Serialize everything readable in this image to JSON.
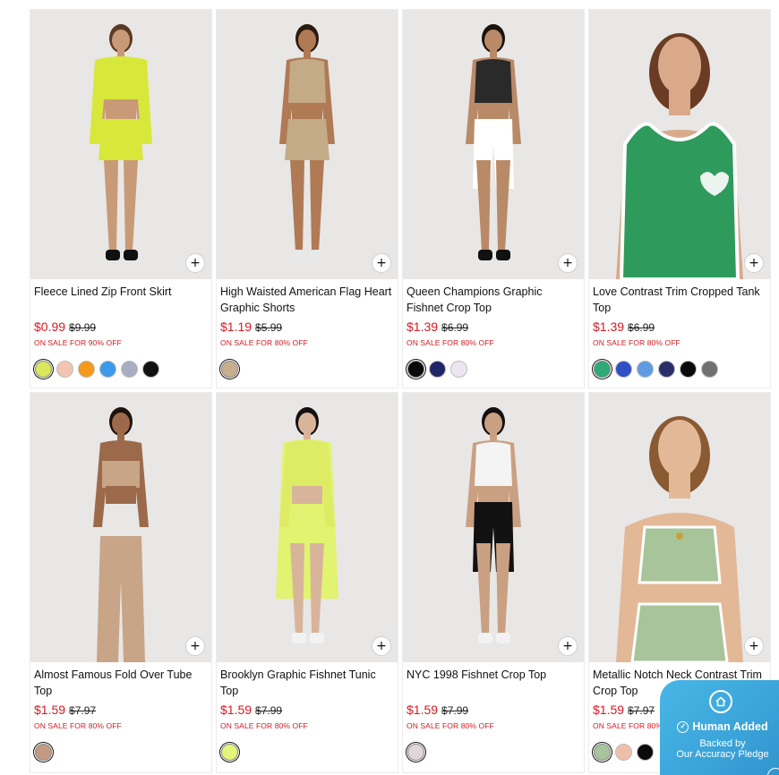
{
  "products": [
    {
      "name": "Fleece Lined Zip Front Skirt",
      "price": "$0.99",
      "original_price": "$9.99",
      "sale_text": "ON SALE FOR 90% OFF",
      "quick_add": "+",
      "outfit": {
        "top": "#d8e83a",
        "bottom": "#d8e83a",
        "skin": "#c99a78",
        "hair": "#5a3a22",
        "shoes": "#111111",
        "style": "skirt"
      },
      "swatches": [
        {
          "color": "#d9e85a",
          "selected": true
        },
        {
          "color": "#f3c4b2",
          "selected": false
        },
        {
          "color": "#f39a1c",
          "selected": false
        },
        {
          "color": "#3b9be8",
          "selected": false
        },
        {
          "color": "#a9acc3",
          "selected": false
        },
        {
          "color": "#111111",
          "selected": false
        }
      ]
    },
    {
      "name": "High Waisted American Flag Heart Graphic Shorts",
      "price": "$1.19",
      "original_price": "$5.99",
      "sale_text": "ON SALE FOR 80% OFF",
      "quick_add": "+",
      "outfit": {
        "top": "#c4ab88",
        "bottom": "#c4ab88",
        "skin": "#b07a55",
        "hair": "#2a1a10",
        "shoes": "#e8e8e8",
        "style": "shorts"
      },
      "swatches": [
        {
          "color": "#c9ad8c",
          "selected": true
        }
      ]
    },
    {
      "name": "Queen Champions Graphic Fishnet Crop Top",
      "price": "$1.39",
      "original_price": "$6.99",
      "sale_text": "ON SALE FOR 80% OFF",
      "quick_add": "+",
      "outfit": {
        "top": "#2a2a2a",
        "bottom": "#ffffff",
        "skin": "#b98a68",
        "hair": "#1a120c",
        "shoes": "#111111",
        "style": "biker"
      },
      "swatches": [
        {
          "color": "#0a0a0a",
          "selected": true
        },
        {
          "color": "#1f2566",
          "selected": false
        },
        {
          "color": "#ece6f2",
          "selected": false
        }
      ]
    },
    {
      "name": "Love Contrast Trim Cropped Tank Top",
      "price": "$1.39",
      "original_price": "$6.99",
      "sale_text": "ON SALE FOR 80% OFF",
      "quick_add": "+",
      "outfit": {
        "top": "#2e9a5c",
        "bottom": "#ffffff",
        "skin": "#d9a98a",
        "hair": "#6b3c24",
        "shoes": "#111111",
        "style": "closeup"
      },
      "swatches": [
        {
          "color": "#2eaa78",
          "selected": true
        },
        {
          "color": "#2f4fc6",
          "selected": false
        },
        {
          "color": "#5f9be0",
          "selected": false
        },
        {
          "color": "#2a2f6a",
          "selected": false
        },
        {
          "color": "#0a0a0a",
          "selected": false
        },
        {
          "color": "#707070",
          "selected": false
        }
      ]
    },
    {
      "name": "Almost Famous Fold Over Tube Top",
      "price": "$1.59",
      "original_price": "$7.97",
      "sale_text": "ON SALE FOR 80% OFF",
      "quick_add": "+",
      "outfit": {
        "top": "#c8a586",
        "bottom": "#c8a586",
        "skin": "#9c6a4a",
        "hair": "#1e130c",
        "shoes": "#111111",
        "style": "tube"
      },
      "swatches": [
        {
          "color": "#c49a84",
          "selected": true
        }
      ]
    },
    {
      "name": "Brooklyn Graphic Fishnet Tunic Top",
      "price": "$1.59",
      "original_price": "$7.99",
      "sale_text": "ON SALE FOR 80% OFF",
      "quick_add": "+",
      "outfit": {
        "top": "#dff55a",
        "bottom": "#dff55a",
        "skin": "#d8b49a",
        "hair": "#141010",
        "shoes": "#f2f2f2",
        "style": "tunic"
      },
      "swatches": [
        {
          "color": "#e3f57a",
          "selected": true
        }
      ]
    },
    {
      "name": "NYC 1998 Fishnet Crop Top",
      "price": "$1.59",
      "original_price": "$7.99",
      "sale_text": "ON SALE FOR 80% OFF",
      "quick_add": "+",
      "outfit": {
        "top": "#f4f4f4",
        "bottom": "#111111",
        "skin": "#caa083",
        "hair": "#141010",
        "shoes": "#f2f2f2",
        "style": "biker"
      },
      "swatches": [
        {
          "color": "#e2d6da",
          "selected": true
        }
      ]
    },
    {
      "name": "Metallic Notch Neck Contrast Trim Crop Top",
      "price": "$1.59",
      "original_price": "$7.97",
      "sale_text": "ON SALE FOR 80% OFF",
      "quick_add": "+",
      "outfit": {
        "top": "#a8c49a",
        "bottom": "#a8c49a",
        "skin": "#e3b897",
        "hair": "#8a5a32",
        "shoes": "#111111",
        "style": "closeup-skirt"
      },
      "swatches": [
        {
          "color": "#a9c49d",
          "selected": true
        },
        {
          "color": "#efbfab",
          "selected": false
        },
        {
          "color": "#0a0a0a",
          "selected": false
        }
      ]
    }
  ],
  "badge": {
    "title": "Human Added",
    "subtitle_line1": "Backed by",
    "subtitle_line2": "Our Accuracy Pledge",
    "icon": "home-circle-icon",
    "check_icon": "check-circle-icon"
  }
}
